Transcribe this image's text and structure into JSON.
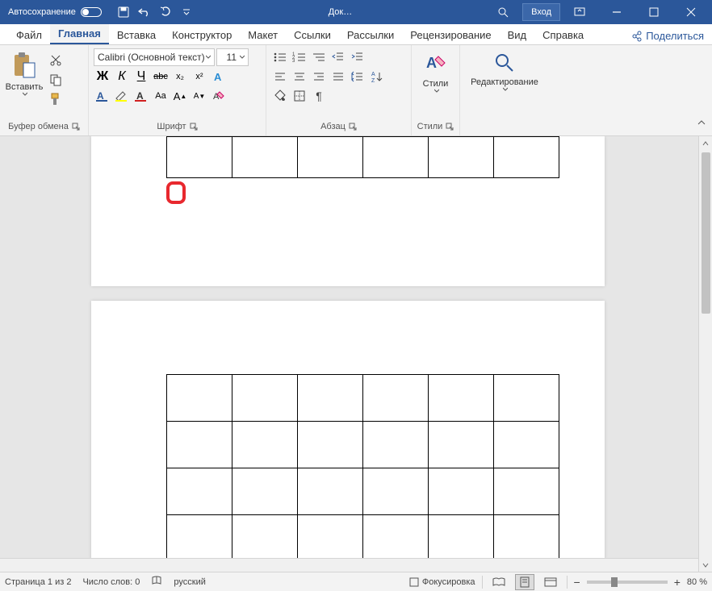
{
  "titlebar": {
    "autosave": "Автосохранение",
    "doc_title": "Док…",
    "login": "Вход"
  },
  "tabs": {
    "file": "Файл",
    "home": "Главная",
    "insert": "Вставка",
    "design": "Конструктор",
    "layout": "Макет",
    "references": "Ссылки",
    "mailings": "Рассылки",
    "review": "Рецензирование",
    "view": "Вид",
    "help": "Справка",
    "share": "Поделиться"
  },
  "ribbon": {
    "clipboard": {
      "paste": "Вставить",
      "label": "Буфер обмена"
    },
    "font": {
      "name": "Calibri (Основной текст)",
      "size": "11",
      "label": "Шрифт",
      "bold": "Ж",
      "italic": "К",
      "underline": "Ч",
      "strike": "abc",
      "sub": "x₂",
      "sup": "x²",
      "Aplus": "A",
      "Aminus": "A",
      "Aa": "Aa"
    },
    "paragraph": {
      "label": "Абзац"
    },
    "styles": {
      "btn": "Стили",
      "label": "Стили"
    },
    "editing": {
      "btn": "Редактирование"
    }
  },
  "status": {
    "page": "Страница 1 из 2",
    "words": "Число слов: 0",
    "lang": "русский",
    "focus": "Фокусировка",
    "zoom": "80 %"
  }
}
